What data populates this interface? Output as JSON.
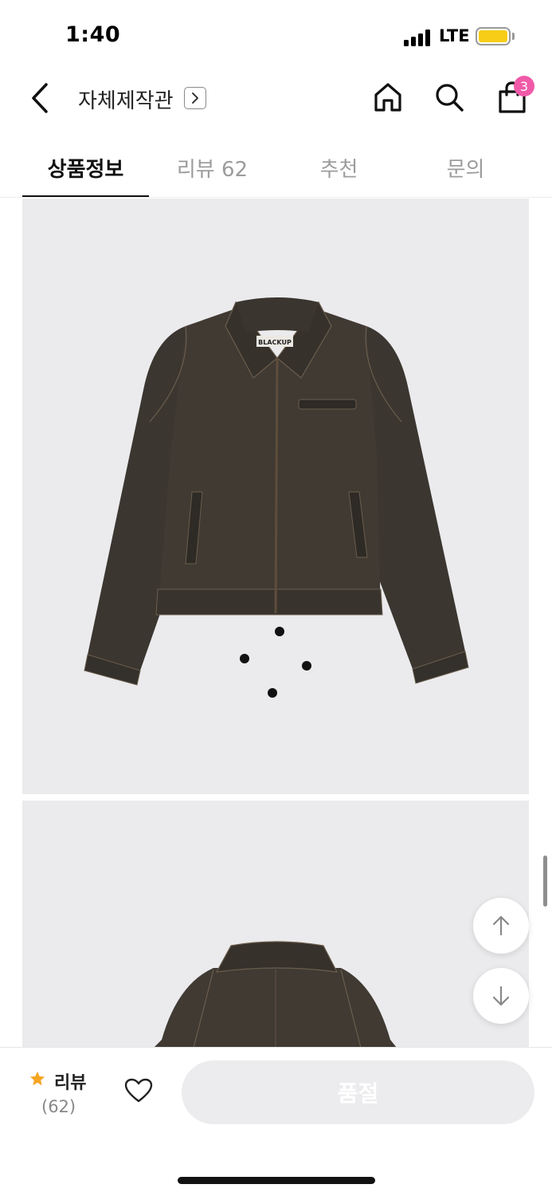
{
  "status_bar": {
    "time": "1:40",
    "network": "LTE",
    "battery_color": "#f7cd17"
  },
  "header": {
    "title": "자체제작관",
    "cart_count": "3",
    "badge_color": "#f05aa8",
    "icons": [
      "chevron-left-icon",
      "chevron-right-icon",
      "home-icon",
      "search-icon",
      "shopping-bag-icon"
    ]
  },
  "tabs": [
    {
      "label": "상품정보",
      "active": true
    },
    {
      "label": "리뷰 62",
      "active": false
    },
    {
      "label": "추천",
      "active": false
    },
    {
      "label": "문의",
      "active": false
    }
  ],
  "product_images": [
    {
      "subject": "jacket-front"
    },
    {
      "subject": "jacket-back"
    }
  ],
  "product_image_label": "BLACKUP",
  "floating_buttons": [
    "arrow-up-icon",
    "arrow-down-icon"
  ],
  "bottom_bar": {
    "review_label": "리뷰",
    "review_count": "(62)",
    "star_color": "#f5a623",
    "soldout_label": "품절"
  }
}
